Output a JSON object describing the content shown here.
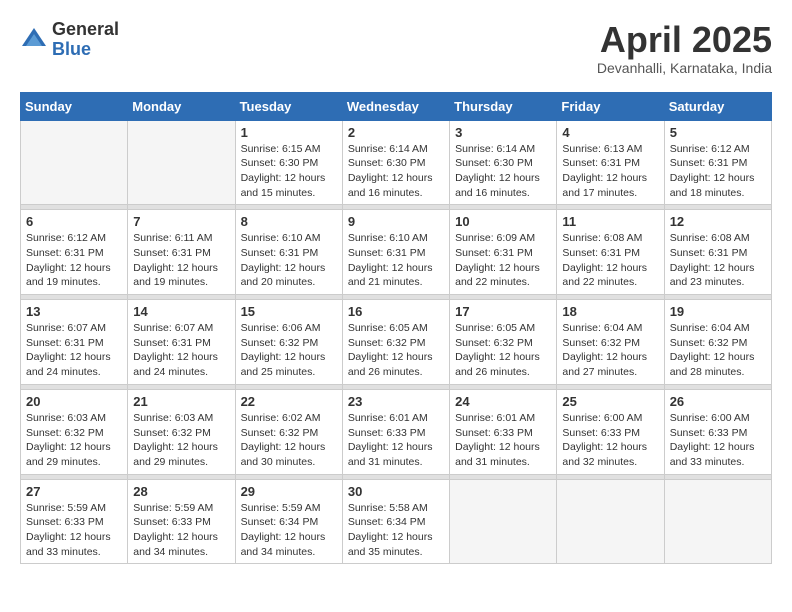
{
  "logo": {
    "general": "General",
    "blue": "Blue"
  },
  "title": "April 2025",
  "subtitle": "Devanhalli, Karnataka, India",
  "days_of_week": [
    "Sunday",
    "Monday",
    "Tuesday",
    "Wednesday",
    "Thursday",
    "Friday",
    "Saturday"
  ],
  "weeks": [
    [
      {
        "day": "",
        "empty": true
      },
      {
        "day": "",
        "empty": true
      },
      {
        "day": "1",
        "sunrise": "6:15 AM",
        "sunset": "6:30 PM",
        "daylight": "12 hours and 15 minutes."
      },
      {
        "day": "2",
        "sunrise": "6:14 AM",
        "sunset": "6:30 PM",
        "daylight": "12 hours and 16 minutes."
      },
      {
        "day": "3",
        "sunrise": "6:14 AM",
        "sunset": "6:30 PM",
        "daylight": "12 hours and 16 minutes."
      },
      {
        "day": "4",
        "sunrise": "6:13 AM",
        "sunset": "6:31 PM",
        "daylight": "12 hours and 17 minutes."
      },
      {
        "day": "5",
        "sunrise": "6:12 AM",
        "sunset": "6:31 PM",
        "daylight": "12 hours and 18 minutes."
      }
    ],
    [
      {
        "day": "6",
        "sunrise": "6:12 AM",
        "sunset": "6:31 PM",
        "daylight": "12 hours and 19 minutes."
      },
      {
        "day": "7",
        "sunrise": "6:11 AM",
        "sunset": "6:31 PM",
        "daylight": "12 hours and 19 minutes."
      },
      {
        "day": "8",
        "sunrise": "6:10 AM",
        "sunset": "6:31 PM",
        "daylight": "12 hours and 20 minutes."
      },
      {
        "day": "9",
        "sunrise": "6:10 AM",
        "sunset": "6:31 PM",
        "daylight": "12 hours and 21 minutes."
      },
      {
        "day": "10",
        "sunrise": "6:09 AM",
        "sunset": "6:31 PM",
        "daylight": "12 hours and 22 minutes."
      },
      {
        "day": "11",
        "sunrise": "6:08 AM",
        "sunset": "6:31 PM",
        "daylight": "12 hours and 22 minutes."
      },
      {
        "day": "12",
        "sunrise": "6:08 AM",
        "sunset": "6:31 PM",
        "daylight": "12 hours and 23 minutes."
      }
    ],
    [
      {
        "day": "13",
        "sunrise": "6:07 AM",
        "sunset": "6:31 PM",
        "daylight": "12 hours and 24 minutes."
      },
      {
        "day": "14",
        "sunrise": "6:07 AM",
        "sunset": "6:31 PM",
        "daylight": "12 hours and 24 minutes."
      },
      {
        "day": "15",
        "sunrise": "6:06 AM",
        "sunset": "6:32 PM",
        "daylight": "12 hours and 25 minutes."
      },
      {
        "day": "16",
        "sunrise": "6:05 AM",
        "sunset": "6:32 PM",
        "daylight": "12 hours and 26 minutes."
      },
      {
        "day": "17",
        "sunrise": "6:05 AM",
        "sunset": "6:32 PM",
        "daylight": "12 hours and 26 minutes."
      },
      {
        "day": "18",
        "sunrise": "6:04 AM",
        "sunset": "6:32 PM",
        "daylight": "12 hours and 27 minutes."
      },
      {
        "day": "19",
        "sunrise": "6:04 AM",
        "sunset": "6:32 PM",
        "daylight": "12 hours and 28 minutes."
      }
    ],
    [
      {
        "day": "20",
        "sunrise": "6:03 AM",
        "sunset": "6:32 PM",
        "daylight": "12 hours and 29 minutes."
      },
      {
        "day": "21",
        "sunrise": "6:03 AM",
        "sunset": "6:32 PM",
        "daylight": "12 hours and 29 minutes."
      },
      {
        "day": "22",
        "sunrise": "6:02 AM",
        "sunset": "6:32 PM",
        "daylight": "12 hours and 30 minutes."
      },
      {
        "day": "23",
        "sunrise": "6:01 AM",
        "sunset": "6:33 PM",
        "daylight": "12 hours and 31 minutes."
      },
      {
        "day": "24",
        "sunrise": "6:01 AM",
        "sunset": "6:33 PM",
        "daylight": "12 hours and 31 minutes."
      },
      {
        "day": "25",
        "sunrise": "6:00 AM",
        "sunset": "6:33 PM",
        "daylight": "12 hours and 32 minutes."
      },
      {
        "day": "26",
        "sunrise": "6:00 AM",
        "sunset": "6:33 PM",
        "daylight": "12 hours and 33 minutes."
      }
    ],
    [
      {
        "day": "27",
        "sunrise": "5:59 AM",
        "sunset": "6:33 PM",
        "daylight": "12 hours and 33 minutes."
      },
      {
        "day": "28",
        "sunrise": "5:59 AM",
        "sunset": "6:33 PM",
        "daylight": "12 hours and 34 minutes."
      },
      {
        "day": "29",
        "sunrise": "5:59 AM",
        "sunset": "6:34 PM",
        "daylight": "12 hours and 34 minutes."
      },
      {
        "day": "30",
        "sunrise": "5:58 AM",
        "sunset": "6:34 PM",
        "daylight": "12 hours and 35 minutes."
      },
      {
        "day": "",
        "empty": true
      },
      {
        "day": "",
        "empty": true
      },
      {
        "day": "",
        "empty": true
      }
    ]
  ],
  "labels": {
    "sunrise": "Sunrise:",
    "sunset": "Sunset:",
    "daylight": "Daylight:"
  }
}
